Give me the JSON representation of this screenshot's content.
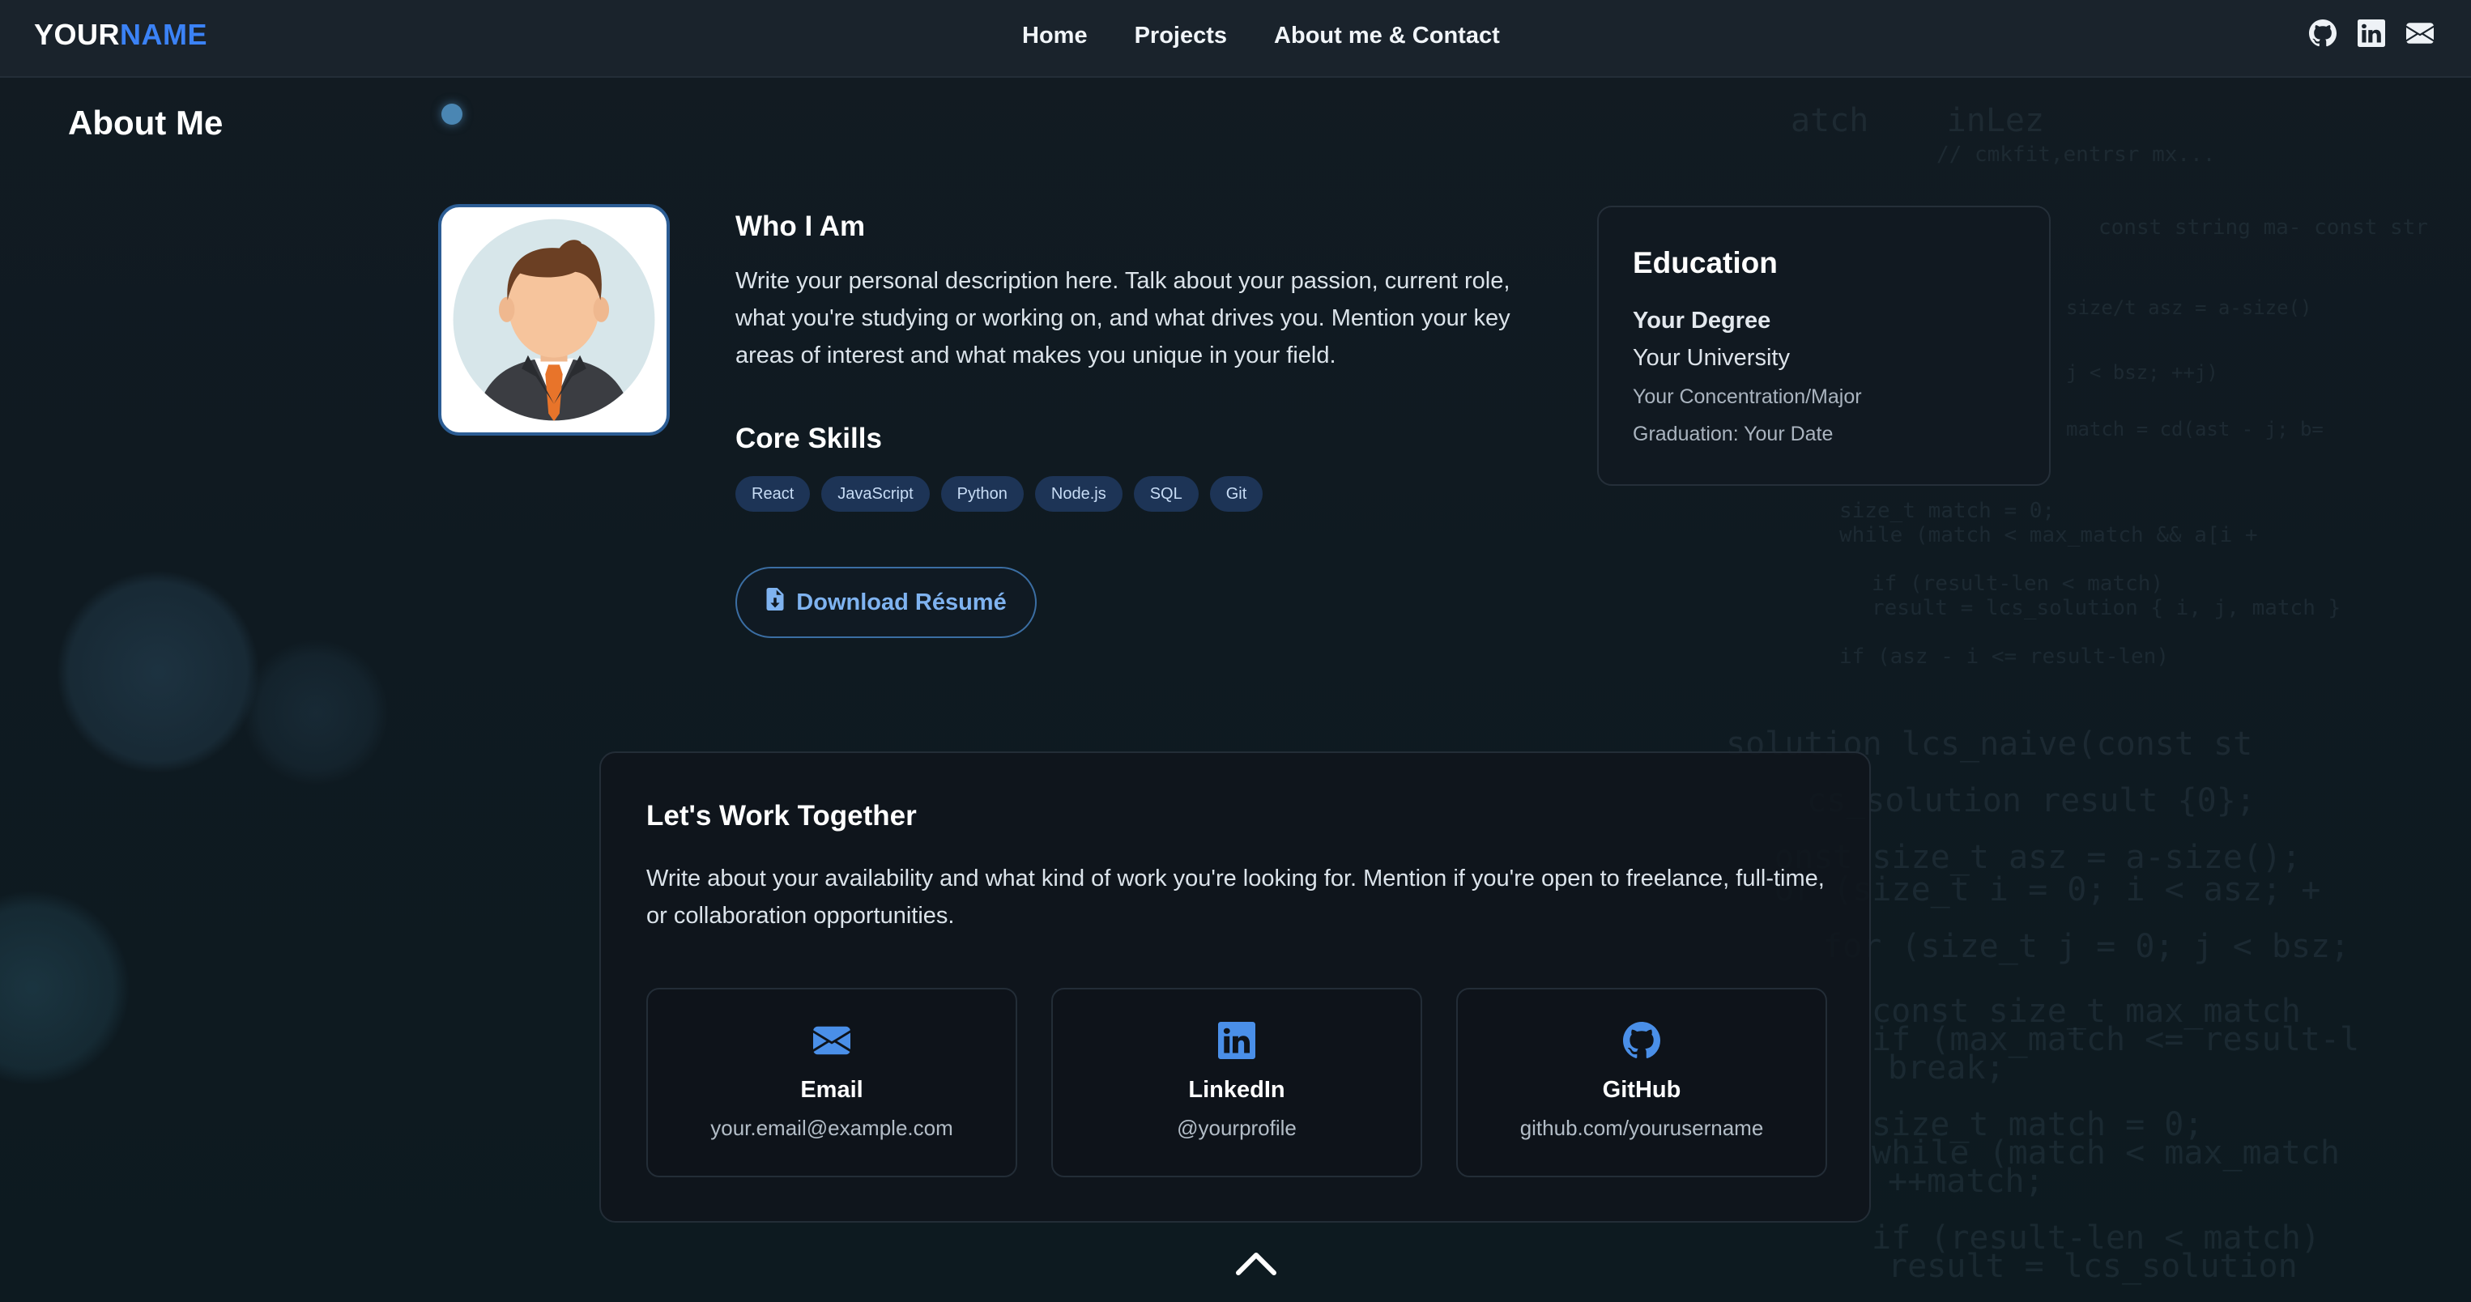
{
  "nav": {
    "logo_part1": "YOUR",
    "logo_part2": "NAME",
    "links": [
      "Home",
      "Projects",
      "About me & Contact"
    ],
    "icons": [
      "github-icon",
      "linkedin-icon",
      "email-icon"
    ]
  },
  "page": {
    "title": "About Me"
  },
  "who": {
    "title": "Who I Am",
    "description": "Write your personal description here. Talk about your passion, current role, what you're studying or working on, and what drives you. Mention your key areas of interest and what makes you unique in your field."
  },
  "skills": {
    "title": "Core Skills",
    "items": [
      "React",
      "JavaScript",
      "Python",
      "Node.js",
      "SQL",
      "Git"
    ]
  },
  "download": {
    "label": "Download Résumé",
    "icon": "file-download-icon"
  },
  "education": {
    "title": "Education",
    "degree": "Your Degree",
    "university": "Your University",
    "major": "Your Concentration/Major",
    "graduation": "Graduation: Your Date"
  },
  "work": {
    "title": "Let's Work Together",
    "text": "Write about your availability and what kind of work you're looking for. Mention if you're open to freelance, full-time, or collaboration opportunities.",
    "cards": [
      {
        "title": "Email",
        "value": "your.email@example.com",
        "icon": "email-icon"
      },
      {
        "title": "LinkedIn",
        "value": "@yourprofile",
        "icon": "linkedin-icon"
      },
      {
        "title": "GitHub",
        "value": "github.com/yourusername",
        "icon": "github-icon"
      }
    ]
  },
  "scroll_top": {
    "icon": "chevron-up-icon"
  },
  "colors": {
    "accent": "#3b82f6",
    "chip_bg": "#1d3456",
    "background": "#0f1a21"
  }
}
